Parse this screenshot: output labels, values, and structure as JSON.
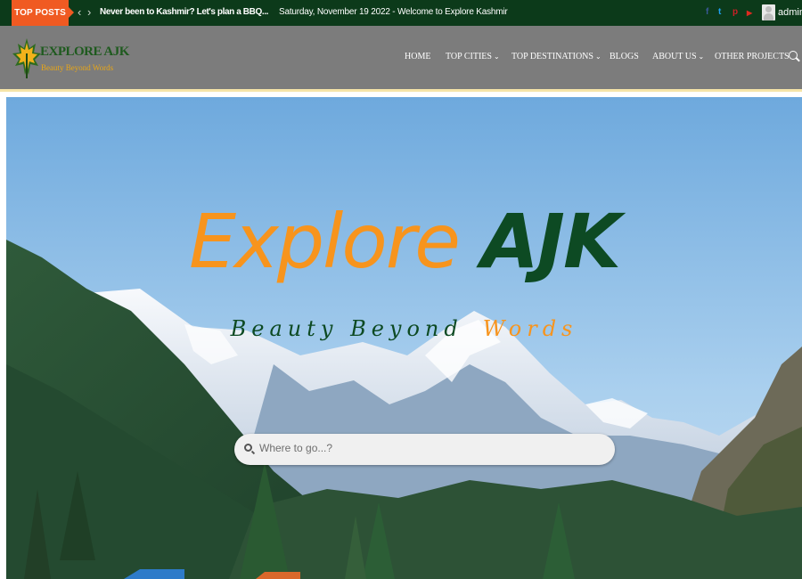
{
  "topbar": {
    "label": "TOP POSTS",
    "ticker": "Never been to Kashmir? Let's plan a BBQ...",
    "date_welcome": "Saturday, November 19 2022 - Welcome to Explore Kashmir",
    "prev_arrow": "‹",
    "next_arrow": "›",
    "social": [
      {
        "icon": "facebook-icon",
        "glyph": "f",
        "color": "#3b5998"
      },
      {
        "icon": "twitter-icon",
        "glyph": "t",
        "color": "#1da1f2"
      },
      {
        "icon": "pinterest-icon",
        "glyph": "p",
        "color": "#cb2027"
      },
      {
        "icon": "youtube-icon",
        "glyph": "▶",
        "color": "#e02a20"
      }
    ],
    "user": "admin"
  },
  "header": {
    "logo_title": "EXPLORE AJK",
    "logo_sub": "Beauty Beyond Words",
    "nav": [
      {
        "label": "HOME",
        "dropdown": false
      },
      {
        "label": "TOP CITIES",
        "dropdown": true
      },
      {
        "label": "TOP DESTINATIONS",
        "dropdown": true
      },
      {
        "label": "BLOGS",
        "dropdown": false
      },
      {
        "label": "ABOUT US",
        "dropdown": true
      },
      {
        "label": "OTHER PROJECTS",
        "dropdown": false
      }
    ],
    "chevron": "⌄"
  },
  "hero": {
    "title_part1": "Explore",
    "title_part2": "AJK",
    "subtitle_part1": "Beauty Beyond",
    "subtitle_part2": "Words",
    "search_placeholder": "Where to go...?"
  },
  "colors": {
    "topbar_bg": "#0c3a1a",
    "accent_orange": "#f7941d",
    "brand_green": "#0d4a23",
    "header_bg": "#7c7c7c",
    "label_bg": "#f05a22"
  }
}
